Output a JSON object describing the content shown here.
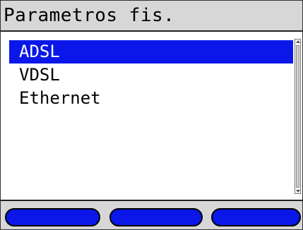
{
  "title": "Parametros fis.",
  "list": {
    "items": [
      {
        "label": "ADSL",
        "selected": true
      },
      {
        "label": "VDSL",
        "selected": false
      },
      {
        "label": "Ethernet",
        "selected": false
      }
    ]
  },
  "softkeys": [
    {
      "label": ""
    },
    {
      "label": ""
    },
    {
      "label": ""
    }
  ],
  "colors": {
    "selection": "#0a17e8",
    "title_bg": "#d7d7d7",
    "softkey": "#0a17e8"
  }
}
